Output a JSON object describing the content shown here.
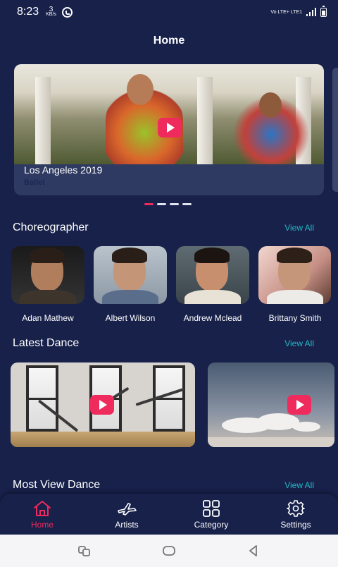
{
  "status_bar": {
    "time": "8:23",
    "speed_value": "3",
    "speed_unit": "KB/s",
    "network": "Vo LTE+ LTE1"
  },
  "header": {
    "title": "Home"
  },
  "hero": {
    "title": "Los Angeles 2019",
    "subtitle": "Ballet",
    "slide_count": 4,
    "active_slide": 1
  },
  "choreographer": {
    "title": "Choreographer",
    "view_all": "View All",
    "items": [
      {
        "name": "Adan Mathew"
      },
      {
        "name": "Albert Wilson"
      },
      {
        "name": "Andrew Mclead"
      },
      {
        "name": "Brittany Smith"
      }
    ]
  },
  "latest_dance": {
    "title": "Latest Dance",
    "view_all": "View All"
  },
  "most_view": {
    "title": "Most View Dance",
    "view_all": "View All"
  },
  "bottom_nav": {
    "items": [
      {
        "label": "Home",
        "icon": "home-icon",
        "active": true
      },
      {
        "label": "Artists",
        "icon": "artists-icon",
        "active": false
      },
      {
        "label": "Category",
        "icon": "category-icon",
        "active": false
      },
      {
        "label": "Settings",
        "icon": "settings-icon",
        "active": false
      }
    ]
  },
  "colors": {
    "background": "#17214a",
    "accent": "#ef2a5d",
    "link": "#26b7c3"
  }
}
